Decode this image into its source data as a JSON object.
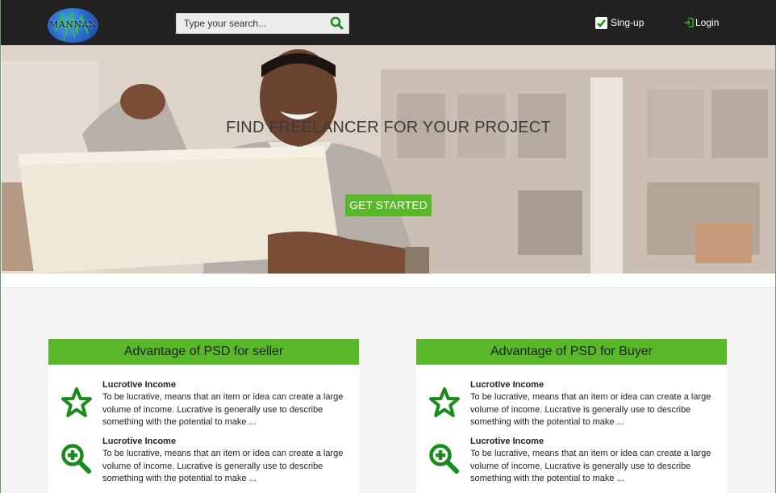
{
  "header": {
    "logo_text": "MANNAN",
    "search_placeholder": "Type your search...",
    "signup_label": "Sing-up",
    "login_label": "Login"
  },
  "hero": {
    "title": "FIND FREELANCER FOR YOUR PROJECT",
    "cta_label": "GET STARTED"
  },
  "cards": [
    {
      "title": "Advantage of PSD for seller",
      "features": [
        {
          "icon": "star-icon",
          "title": "Lucrotive Income",
          "text": "To be lucrative, means that an item or idea can create a large volume of income. Lucrative is generally use to describe something with the potential to make ..."
        },
        {
          "icon": "zoom-in-icon",
          "title": "Lucrotive Income",
          "text": "To be lucrative, means that an item or idea can create a large volume of income. Lucrative is generally use to describe something with the potential to make ..."
        }
      ]
    },
    {
      "title": "Advantage of PSD for Buyer",
      "features": [
        {
          "icon": "star-icon",
          "title": "Lucrotive Income",
          "text": "To be lucrative, means that an item or idea can create a large volume of income. Lucrative is generally use to describe something with the potential to make ..."
        },
        {
          "icon": "zoom-in-icon",
          "title": "Lucrotive Income",
          "text": "To be lucrative, means that an item or idea can create a large volume of income. Lucrative is generally use to describe something with the potential to make ..."
        }
      ]
    }
  ],
  "colors": {
    "accent_green": "#58b82a",
    "icon_green": "#1a8a1a",
    "header_bg": "#222222"
  }
}
